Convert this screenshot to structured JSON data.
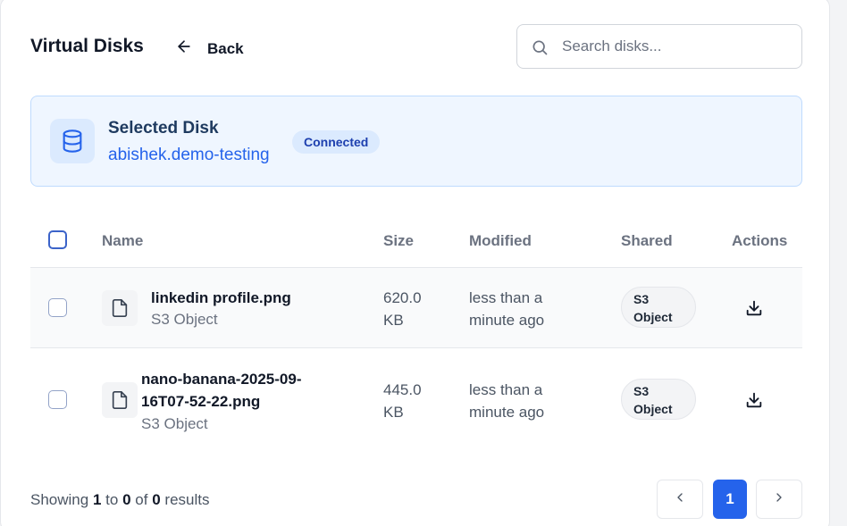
{
  "header": {
    "title": "Virtual Disks",
    "back_label": "Back"
  },
  "search": {
    "placeholder": "Search disks..."
  },
  "selected_disk": {
    "label": "Selected Disk",
    "name": "abishek.demo-testing",
    "status": "Connected"
  },
  "table": {
    "columns": [
      "Name",
      "Size",
      "Modified",
      "Shared",
      "Actions"
    ],
    "rows": [
      {
        "name": "linkedin profile.png",
        "type": "S3 Object",
        "size_value": "620.0",
        "size_unit": "KB",
        "modified_line1": "less than a",
        "modified_line2": "minute ago",
        "shared_line1": "S3",
        "shared_line2": "Object"
      },
      {
        "name_line1": "nano-banana-2025-09-",
        "name_line2": "16T07-52-22.png",
        "type": "S3 Object",
        "size_value": "445.0",
        "size_unit": "KB",
        "modified_line1": "less than a",
        "modified_line2": "minute ago",
        "shared_line1": "S3",
        "shared_line2": "Object"
      }
    ]
  },
  "footer": {
    "showing_prefix": "Showing",
    "from": "1",
    "to_word": "to",
    "to": "0",
    "of_word": "of",
    "total": "0",
    "suffix": "results",
    "current_page": "1"
  },
  "icons": {
    "back": "arrow-left-icon",
    "search": "search-icon",
    "disk": "database-icon",
    "file": "file-icon",
    "download": "download-icon",
    "prev": "chevron-left-icon",
    "next": "chevron-right-icon"
  },
  "colors": {
    "accent": "#2563eb",
    "selected_bg": "#eff6ff",
    "selected_border": "#bfdbfe"
  }
}
